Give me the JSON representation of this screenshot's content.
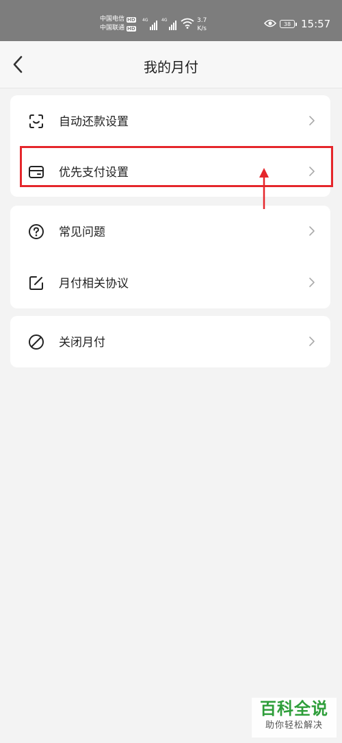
{
  "status_bar": {
    "carrier1": "中国电信",
    "carrier2": "中国联通",
    "hd": "HD",
    "network": "4G",
    "speed_value": "3.7",
    "speed_unit": "K/s",
    "battery": "38",
    "time": "15:57"
  },
  "header": {
    "title": "我的月付"
  },
  "menu": {
    "auto_repay": "自动还款设置",
    "priority_pay": "优先支付设置",
    "faq": "常见问题",
    "agreements": "月付相关协议",
    "close": "关闭月付"
  },
  "colors": {
    "status_bar_bg": "#7d7d7d",
    "highlight": "#e5262b",
    "page_bg": "#f3f3f3"
  },
  "watermark": {
    "main": "百科全说",
    "sub": "助你轻松解决"
  }
}
